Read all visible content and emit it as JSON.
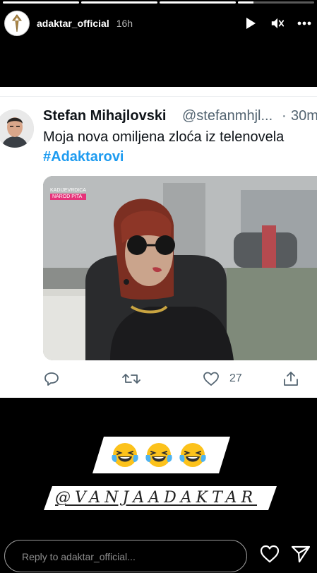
{
  "story": {
    "segments": [
      1,
      1,
      1,
      0.2
    ],
    "username": "adaktar_official",
    "time": "16h"
  },
  "tweet": {
    "name": "Stefan Mihajlovski",
    "handle": "@stefanmhjl...",
    "dot": "·",
    "time": "30m",
    "text": "Moja nova omiljena zloća iz telenovela",
    "hashtag": "#Adaktarovi",
    "media_caption_line1": "KADIJEVRDICA",
    "media_caption_line2": "NAROD PITA",
    "likes": "27"
  },
  "stickers": {
    "emojis": [
      "laughing-crying",
      "laughing-crying",
      "laughing-crying"
    ],
    "mention": "@VANJAADAKTAR"
  },
  "reply": {
    "placeholder": "Reply to adaktar_official..."
  },
  "colors": {
    "background": "#000000",
    "tweet_bg": "#ffffff",
    "hashtag": "#1d9bf0",
    "muted": "#536471"
  }
}
